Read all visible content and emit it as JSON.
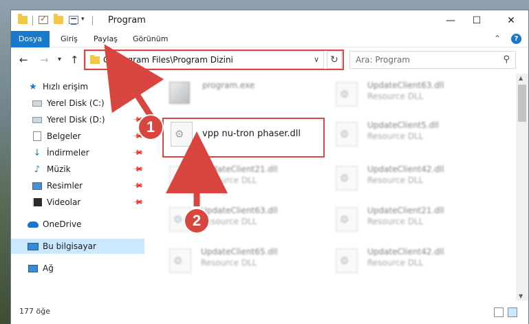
{
  "window": {
    "title": "Program",
    "controls": {
      "minimize": "—",
      "maximize": "☐",
      "close": "✕"
    }
  },
  "ribbon": {
    "tabs": [
      "Dosya",
      "Giriş",
      "Paylaş",
      "Görünüm"
    ]
  },
  "navigation": {
    "address": "C:\\Program Files\\Program Dizini",
    "search_placeholder": "Ara: Program"
  },
  "sidebar": {
    "items": [
      {
        "label": "Hızlı erişim",
        "icon": "star-icon"
      },
      {
        "label": "Yerel Disk (C:)",
        "icon": "drive-icon"
      },
      {
        "label": "Yerel Disk (D:)",
        "icon": "drive-icon"
      },
      {
        "label": "Belgeler",
        "icon": "documents-icon"
      },
      {
        "label": "İndirmeler",
        "icon": "download-icon"
      },
      {
        "label": "Müzik",
        "icon": "music-icon"
      },
      {
        "label": "Resimler",
        "icon": "pictures-icon"
      },
      {
        "label": "Videolar",
        "icon": "video-icon"
      },
      {
        "label": "OneDrive",
        "icon": "cloud-icon"
      },
      {
        "label": "Bu bilgisayar",
        "icon": "computer-icon"
      },
      {
        "label": "Ağ",
        "icon": "network-icon"
      }
    ]
  },
  "files": {
    "program_exe": "program.exe",
    "highlighted": "vpp nu-tron phaser.dll",
    "items": [
      {
        "name": "UpdateClient63.dll",
        "desc": "Resource DLL"
      },
      {
        "name": "UpdateClient5.dll",
        "desc": "Resource DLL"
      },
      {
        "name": "UpdateClient21.dll",
        "desc": "Resource DLL"
      },
      {
        "name": "UpdateClient42.dll",
        "desc": "Resource DLL"
      },
      {
        "name": "UpdateClient63.dll",
        "desc": "Resource DLL"
      },
      {
        "name": "UpdateClient21.dll",
        "desc": "Resource DLL"
      },
      {
        "name": "UpdateClient65.dll",
        "desc": "Resource DLL"
      },
      {
        "name": "UpdateClient42.dll",
        "desc": "Resource DLL"
      }
    ]
  },
  "status": {
    "item_count": "177 öğe"
  },
  "callouts": [
    "1",
    "2"
  ],
  "colors": {
    "accent": "#1979ca",
    "highlight": "#d9463f",
    "selected": "#cce8ff"
  }
}
